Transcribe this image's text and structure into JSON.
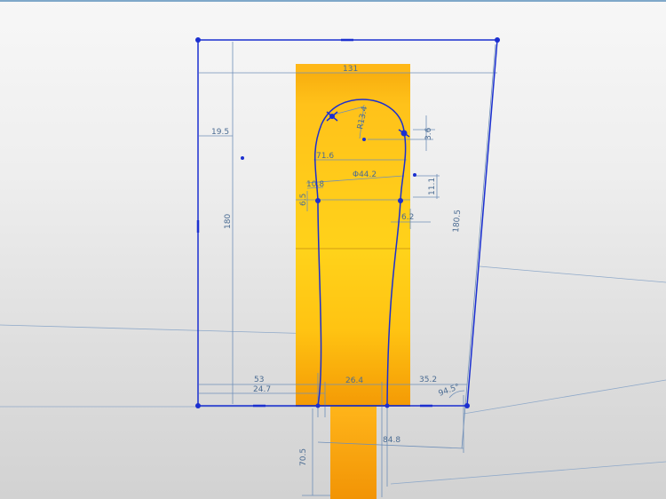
{
  "viewport": {
    "background_top": "#f7f7f7",
    "background_bottom": "#d2d2d2",
    "top_border_color": "#7fa8c9"
  },
  "colors": {
    "sketch_blue": "#1b2fd0",
    "dimension_blue": "#6f8fb8",
    "dimension_text": "#4b6c93",
    "part_orange_light": "#ffd21a",
    "part_orange_dark": "#f09a06"
  },
  "dimensions": {
    "top_width": "131",
    "left_offset_19": "19.5",
    "height_180": "180",
    "radius_r13": "R13.4",
    "offset_3_6": "3.6",
    "width_71_6": "71.6",
    "width_44_2": "Φ44.2",
    "small_10_8": "10.8",
    "vert_11_1": "11.1",
    "small_6_5": "6.5",
    "small_6_2": "6.2",
    "slant_180_5": "180.5",
    "bottom_53": "53",
    "bottom_24_7": "24.7",
    "bottom_26_4": "26.4",
    "bottom_35_2": "35.2",
    "angle_94_5": "94.5°",
    "bottom_84_8": "84.8",
    "vert_70_5": "70.5"
  }
}
